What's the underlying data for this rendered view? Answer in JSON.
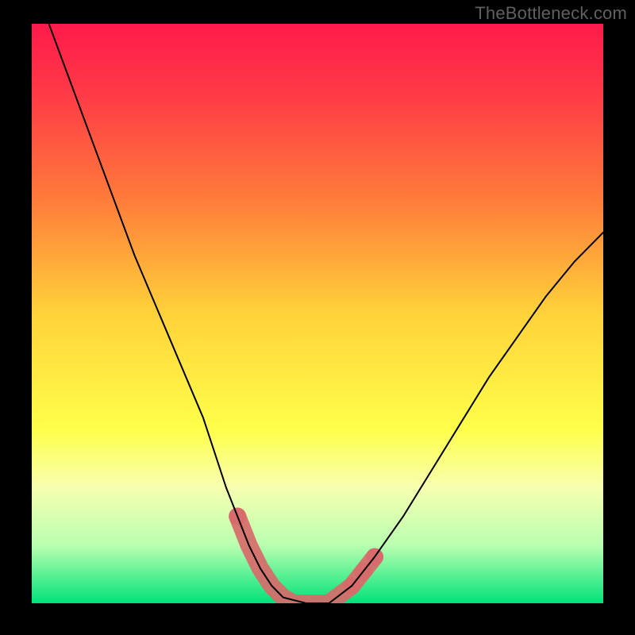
{
  "watermark": "TheBottleneck.com",
  "chart_data": {
    "type": "line",
    "title": "",
    "xlabel": "",
    "ylabel": "",
    "xlim": [
      0,
      100
    ],
    "ylim": [
      0,
      100
    ],
    "background_gradient": {
      "stops": [
        {
          "offset": 0,
          "color": "#ff1a4b"
        },
        {
          "offset": 12,
          "color": "#ff3a47"
        },
        {
          "offset": 30,
          "color": "#ff7a3a"
        },
        {
          "offset": 50,
          "color": "#ffd23a"
        },
        {
          "offset": 70,
          "color": "#ffff4a"
        },
        {
          "offset": 80,
          "color": "#f7ffb0"
        },
        {
          "offset": 90,
          "color": "#b9ffb0"
        },
        {
          "offset": 100,
          "color": "#00e27a"
        }
      ]
    },
    "series": [
      {
        "name": "bottleneck-curve",
        "color": "#000000",
        "width": 2,
        "x": [
          3,
          6,
          9,
          12,
          15,
          18,
          21,
          24,
          27,
          30,
          32,
          34,
          36,
          38,
          40,
          42,
          44,
          48,
          52,
          56,
          60,
          65,
          70,
          75,
          80,
          85,
          90,
          95,
          100
        ],
        "y": [
          100,
          92,
          84,
          76,
          68,
          60,
          53,
          46,
          39,
          32,
          26,
          20,
          15,
          10,
          6,
          3,
          1,
          0,
          0,
          3,
          8,
          15,
          23,
          31,
          39,
          46,
          53,
          59,
          64
        ]
      }
    ],
    "markers": {
      "name": "trough-highlight",
      "color": "#d86a6a",
      "radius": 11,
      "points": [
        {
          "x": 36,
          "y": 15
        },
        {
          "x": 38,
          "y": 10
        },
        {
          "x": 40,
          "y": 6
        },
        {
          "x": 42,
          "y": 3
        },
        {
          "x": 44,
          "y": 1
        },
        {
          "x": 46,
          "y": 0
        },
        {
          "x": 48,
          "y": 0
        },
        {
          "x": 50,
          "y": 0
        },
        {
          "x": 52,
          "y": 0
        },
        {
          "x": 54,
          "y": 1.5
        },
        {
          "x": 56,
          "y": 3
        },
        {
          "x": 58,
          "y": 5.5
        },
        {
          "x": 60,
          "y": 8
        }
      ]
    }
  }
}
